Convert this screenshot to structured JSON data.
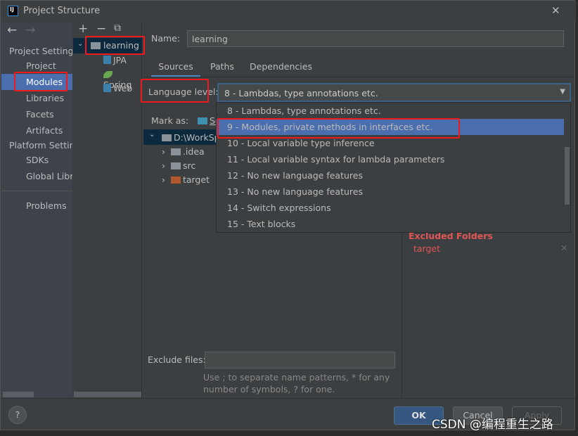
{
  "window": {
    "title": "Project Structure",
    "close": "✕"
  },
  "nav": {
    "back": "←",
    "forward": "→"
  },
  "sidebar": {
    "section1": "Project Settings",
    "items1": [
      "Project",
      "Modules",
      "Libraries",
      "Facets",
      "Artifacts"
    ],
    "section2": "Platform Settings",
    "items2": [
      "SDKs",
      "Global Libraries"
    ],
    "problems": "Problems",
    "selected": "Modules"
  },
  "modules_toolbar": {
    "add": "+",
    "remove": "−",
    "copy": "⧉"
  },
  "module_tree": {
    "root": "learning",
    "children": [
      "JPA",
      "Spring",
      "Web"
    ]
  },
  "name_label": "Name:",
  "name_value": "learning",
  "tabs": [
    "Sources",
    "Paths",
    "Dependencies"
  ],
  "active_tab": "Sources",
  "language_level": {
    "label": "Language level:",
    "value": "8 - Lambdas, type annotations etc.",
    "options": [
      "8 - Lambdas, type annotations etc.",
      "9 - Modules, private methods in interfaces etc.",
      "10 - Local variable type inference",
      "11 - Local variable syntax for lambda parameters",
      "12 - No new language features",
      "13 - No new language features",
      "14 - Switch expressions",
      "15 - Text blocks"
    ],
    "highlighted": "9 - Modules, private methods in interfaces etc."
  },
  "mark_as": {
    "label": "Mark as:",
    "first": "Sources"
  },
  "content_tree": {
    "root": "D:\\WorkSpace",
    "children": [
      ".idea",
      "src",
      "target"
    ]
  },
  "excluded": {
    "title": "Excluded Folders",
    "item": "target"
  },
  "exclude_files": {
    "label": "Exclude files:",
    "value": "",
    "hint": "Use ; to separate name patterns, * for any number of symbols, ? for one."
  },
  "buttons": {
    "help": "?",
    "ok": "OK",
    "cancel": "Cancel",
    "apply": "Apply"
  },
  "watermark": "CSDN @编程重生之路",
  "colors": {
    "accent": "#4b6eaf",
    "annotation": "#f01a1a",
    "excluded": "#e05555"
  }
}
